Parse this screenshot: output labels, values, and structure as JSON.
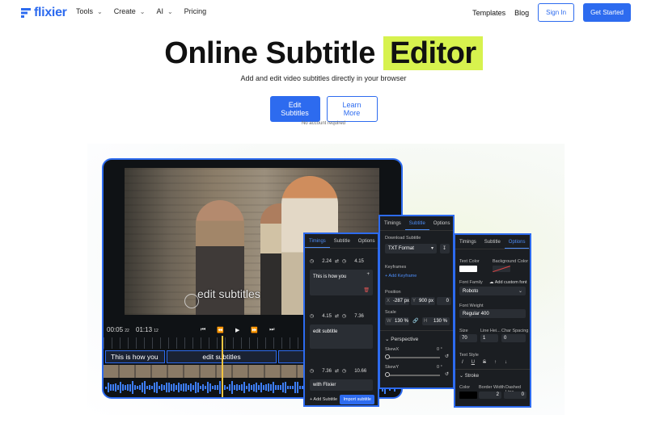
{
  "brand": {
    "name": "flixier",
    "color": "#2d6bef"
  },
  "nav": {
    "items": [
      {
        "label": "Tools",
        "has_dropdown": true
      },
      {
        "label": "Create",
        "has_dropdown": true
      },
      {
        "label": "AI",
        "has_dropdown": true
      },
      {
        "label": "Pricing",
        "has_dropdown": false
      }
    ],
    "templates": "Templates",
    "blog": "Blog",
    "sign_in": "Sign In",
    "get_started": "Get Started"
  },
  "hero": {
    "title_part1": "Online Subtitle",
    "title_highlight": "Editor",
    "highlight_color": "#d7f24e",
    "subtitle": "Add and edit video subtitles directly in your browser",
    "primary_cta": "Edit Subtitles",
    "secondary_cta": "Learn More",
    "note": "No account required"
  },
  "editor": {
    "video_caption": "edit subtitles",
    "time_current": "00:05",
    "time_current_frames": "22",
    "time_total": "01:13",
    "time_total_frames": "12",
    "track_segments": [
      "This is how you",
      "edit subtitles",
      "with Flixier"
    ],
    "panel_a": {
      "tabs": [
        "Timings",
        "Subtitle",
        "Options"
      ],
      "active_tab": "Timings",
      "entries": [
        {
          "start": "2.24",
          "end": "4.15",
          "text": "This is how you"
        },
        {
          "start": "4.15",
          "end": "7.36",
          "text": "edit subtitle"
        },
        {
          "start": "7.36",
          "end": "10.66",
          "text": "with Flixier"
        }
      ],
      "add_subtitle": "+ Add Subtitle",
      "import_subtitle": "Import subtitle"
    },
    "panel_b": {
      "tabs": [
        "Timings",
        "Subtitle",
        "Options"
      ],
      "active_tab": "Subtitle",
      "download_label": "Download Subtitle",
      "format": "TXT Format",
      "keyframes": "Keyframes",
      "add_keyframe": "+ Add Keyframe",
      "position": "Position",
      "x_label": "X",
      "x_value": "-287 px",
      "y_label": "Y",
      "y_value": "900 px",
      "rot_value": "0",
      "scale": "Scale",
      "w_label": "W",
      "w_value": "130 %",
      "h_label": "H",
      "h_value": "130 %",
      "perspective": "Perspective",
      "skew_x": "SkewX",
      "skew_x_value": "0 °",
      "skew_y": "SkewY",
      "skew_y_value": "0 °"
    },
    "panel_c": {
      "tabs": [
        "Timings",
        "Subtitle",
        "Options"
      ],
      "active_tab": "Options",
      "text_color": "Text Color",
      "background_color": "Background Color",
      "font_family": "Font Family",
      "add_custom_font": "Add custom font",
      "font_value": "Roboto",
      "font_weight": "Font Weight",
      "font_weight_value": "Regular 400",
      "size": "Size",
      "line_height": "Line Hei...",
      "char_spacing": "Char Spacing",
      "size_value": "70",
      "line_height_value": "1",
      "char_spacing_value": "0",
      "text_style": "Text Style",
      "stroke": "Stroke",
      "stroke_color": "Color",
      "border_width": "Border Width",
      "dashed_line": "Dashed Line",
      "border_width_value": "2",
      "dashed_line_value": "0"
    }
  }
}
